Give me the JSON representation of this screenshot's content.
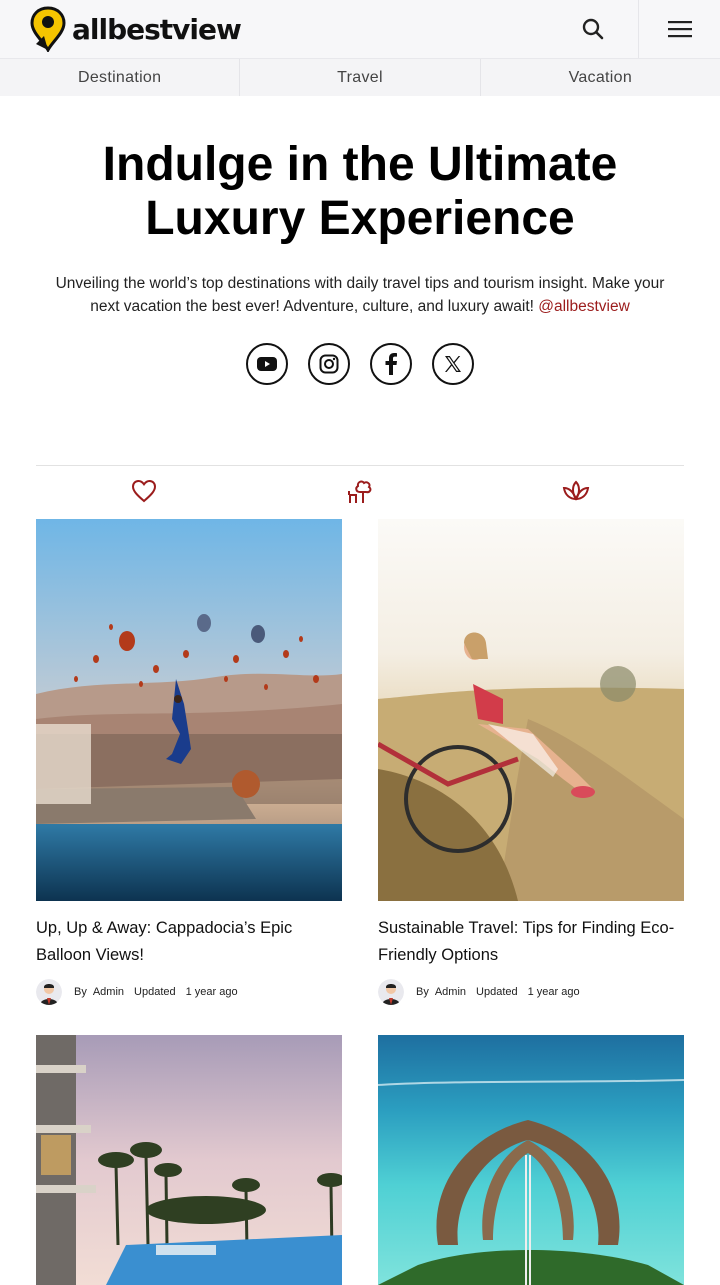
{
  "brand": {
    "name": "allbestview",
    "accent": "#f5c400"
  },
  "nav": {
    "items": [
      "Destination",
      "Travel",
      "Vacation"
    ]
  },
  "hero": {
    "title": "Indulge in the Ultimate Luxury Experience",
    "description": "Unveiling the world’s top destinations with daily travel tips and tourism insight. Make your next vacation the best ever! Adventure, culture, and luxury await!",
    "handle": "@allbestview"
  },
  "social": [
    "youtube-icon",
    "instagram-icon",
    "facebook-icon",
    "x-icon"
  ],
  "tabs": [
    "heart-icon",
    "tree-bench-icon",
    "lotus-icon"
  ],
  "colors": {
    "accent_red": "#9b1c1c"
  },
  "cards": [
    {
      "title": "Up, Up & Away: Cappadocia’s Epic Balloon Views!",
      "by": "By",
      "author": "Admin",
      "updated": "Updated",
      "time": "1 year ago"
    },
    {
      "title": "Sustainable Travel: Tips for Finding Eco-Friendly Options",
      "by": "By",
      "author": "Admin",
      "updated": "Updated",
      "time": "1 year ago"
    },
    {
      "title": "",
      "by": "",
      "author": "",
      "updated": "",
      "time": ""
    },
    {
      "title": "",
      "by": "",
      "author": "",
      "updated": "",
      "time": ""
    }
  ]
}
